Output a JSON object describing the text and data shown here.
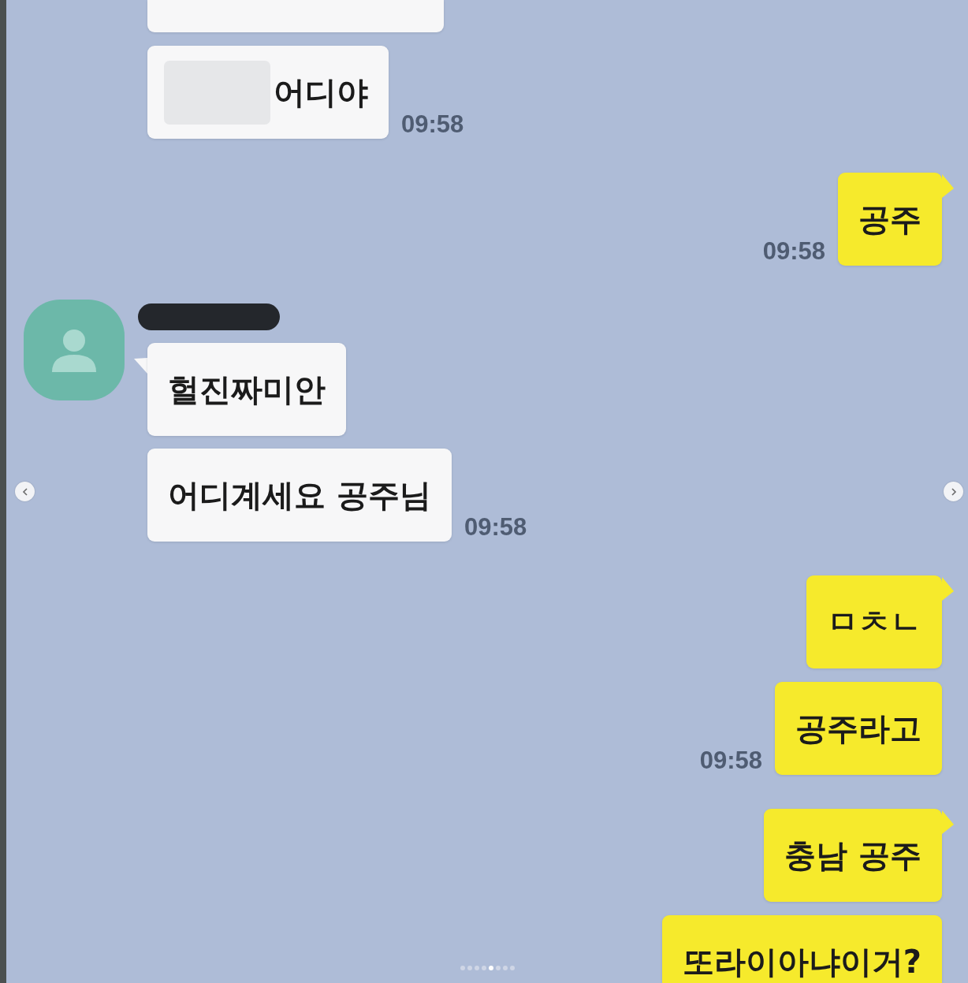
{
  "chat": [
    {
      "kind": "received",
      "messages": [
        {
          "cut_top": true
        },
        {
          "hidden_prefix": true,
          "text": "어디야",
          "time": "09:58"
        }
      ]
    },
    {
      "kind": "sent",
      "messages": [
        {
          "tail": true,
          "text": "공주",
          "time": "09:58"
        }
      ]
    },
    {
      "kind": "received",
      "avatar": true,
      "name_hidden": true,
      "messages": [
        {
          "tail": true,
          "text": "헐진짜미안"
        },
        {
          "text": "어디계세요 공주님",
          "time": "09:58"
        }
      ]
    },
    {
      "kind": "sent",
      "messages": [
        {
          "tail": true,
          "text": "ㅁㅊㄴ"
        },
        {
          "text": "공주라고",
          "time": "09:58"
        }
      ]
    },
    {
      "kind": "sent",
      "messages": [
        {
          "tail": true,
          "text": "충남 공주"
        },
        {
          "cut_bottom": true,
          "text": "또라이아냐이거?"
        }
      ]
    }
  ],
  "carousel": {
    "dots": [
      {
        "selected": false
      },
      {
        "selected": false
      },
      {
        "selected": false
      },
      {
        "selected": false
      },
      {
        "selected": true
      },
      {
        "selected": false
      },
      {
        "selected": false
      },
      {
        "selected": false
      }
    ]
  }
}
